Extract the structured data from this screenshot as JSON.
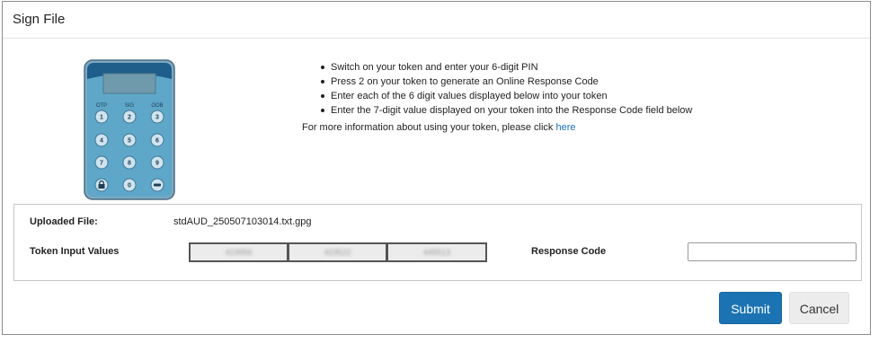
{
  "dialog": {
    "title": "Sign File"
  },
  "token_device": {
    "mode_labels": [
      "OTP",
      "SIG",
      "OOB"
    ],
    "keys": [
      "1",
      "2",
      "3",
      "4",
      "5",
      "6",
      "7",
      "8",
      "9",
      "0"
    ],
    "colors": {
      "body": "#5ea7c8",
      "top": "#1f5d8a",
      "key": "#cfe4ee"
    }
  },
  "instructions": {
    "steps": [
      "Switch on your token and enter your 6-digit PIN",
      "Press 2 on your token to generate an Online Response Code",
      "Enter each of the 6 digit values displayed below into your token",
      "Enter the 7-digit value displayed on your token into the Response Code field below"
    ],
    "more_info_text": "For more information about using your token, please click ",
    "more_info_link": "here"
  },
  "form": {
    "uploaded_file_label": "Uploaded File:",
    "uploaded_file_value": "stdAUD_250507103014.txt.gpg",
    "token_input_label": "Token Input Values",
    "token_values": [
      "419956",
      "423522",
      "445513"
    ],
    "response_code_label": "Response Code",
    "response_code_value": ""
  },
  "buttons": {
    "submit": "Submit",
    "cancel": "Cancel"
  },
  "colors": {
    "accent": "#1b73b3",
    "link": "#1a6fc0"
  }
}
